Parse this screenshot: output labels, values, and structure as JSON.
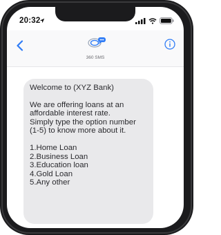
{
  "status_bar": {
    "time": "20:32"
  },
  "conversation": {
    "contact_name": "360 SMS"
  },
  "message": {
    "greeting": "Welcome to (XYZ Bank)",
    "body_lines": [
      "We are offering loans at an",
      "affordable interest rate.",
      "Simply type the option number",
      "(1-5) to know more about it."
    ],
    "options": [
      "1.Home Loan",
      "2.Business Loan",
      "3.Education loan",
      "4.Gold Loan",
      "5.Any other"
    ]
  },
  "colors": {
    "accent": "#2f7cf6",
    "bubble": "#e9e9eb",
    "text": "#2a2a2e"
  },
  "icons": [
    "location-arrow-icon",
    "signal-icon",
    "wifi-icon",
    "battery-icon",
    "back-chevron-icon",
    "info-icon",
    "sender-logo-icon"
  ]
}
